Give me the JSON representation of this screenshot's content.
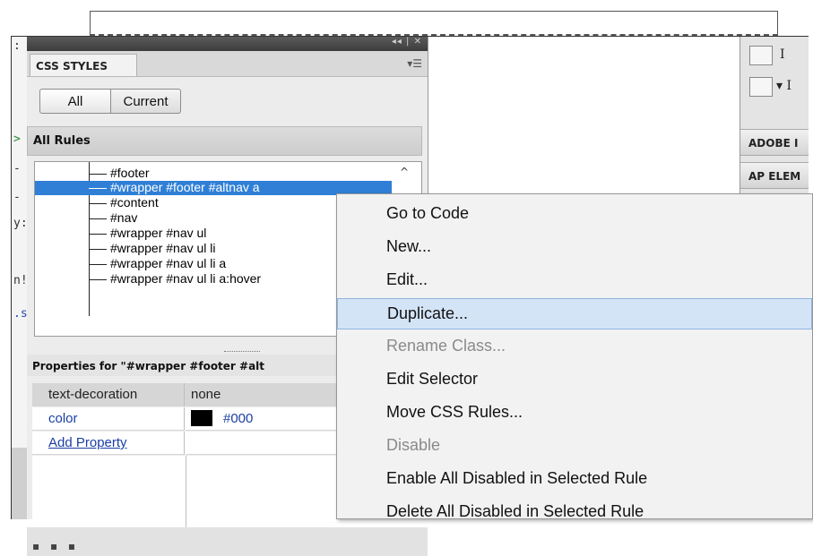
{
  "panel": {
    "tab_label": "CSS STYLES",
    "titlebar_controls": "◂◂ | ✕",
    "menu_icon": "▾☰",
    "segments": [
      "All",
      "Current"
    ],
    "rules_header": "All Rules",
    "rules": [
      {
        "label": "#footer",
        "selected": false
      },
      {
        "label": "#wrapper #footer #altnav a",
        "selected": true
      },
      {
        "label": "#content",
        "selected": false
      },
      {
        "label": "#nav",
        "selected": false
      },
      {
        "label": "#wrapper #nav ul",
        "selected": false
      },
      {
        "label": "#wrapper #nav ul li",
        "selected": false
      },
      {
        "label": "#wrapper #nav ul li a",
        "selected": false
      },
      {
        "label": "#wrapper #nav ul li a:hover",
        "selected": false
      }
    ],
    "properties_header": "Properties for \"#wrapper #footer #alt",
    "properties": [
      {
        "name": "text-decoration",
        "value": "none"
      },
      {
        "name": "color",
        "value": "#000"
      },
      {
        "name": "Add Property",
        "value": ""
      }
    ]
  },
  "gutter": [
    ":",
    ">",
    "-",
    "-",
    "y:",
    "n!",
    ".s"
  ],
  "right_dock": {
    "btn1_label": "I",
    "btn2_label": "▾ I",
    "adobe_label": "ADOBE I",
    "ap_label": "AP ELEM"
  },
  "context_menu": {
    "items": [
      {
        "label": "Go to Code",
        "state": "normal"
      },
      {
        "label": "New...",
        "state": "normal"
      },
      {
        "label": "Edit...",
        "state": "normal"
      },
      {
        "label": "Duplicate...",
        "state": "highlight"
      },
      {
        "label": "Rename Class...",
        "state": "disabled"
      },
      {
        "label": "Edit Selector",
        "state": "normal"
      },
      {
        "label": "Move CSS Rules...",
        "state": "normal"
      },
      {
        "label": "Disable",
        "state": "disabled"
      },
      {
        "label": "Enable All Disabled in Selected Rule",
        "state": "normal"
      },
      {
        "label": "Delete All Disabled in Selected Rule",
        "state": "normal"
      }
    ]
  }
}
